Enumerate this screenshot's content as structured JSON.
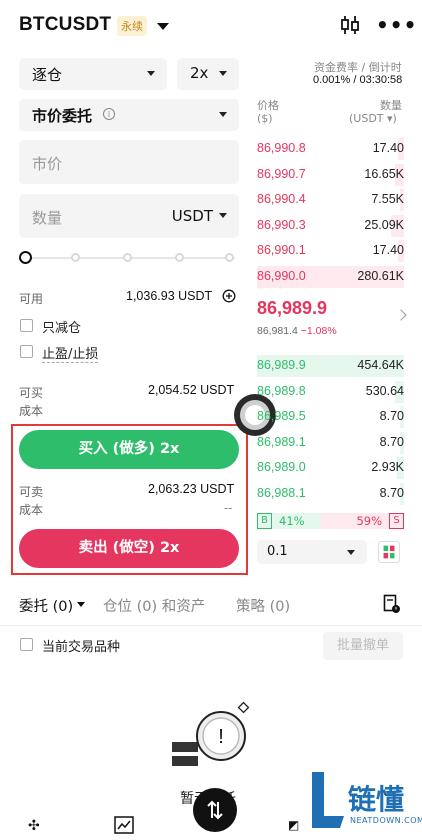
{
  "header": {
    "pair": "BTCUSDT",
    "badge": "永续"
  },
  "left": {
    "margin_mode": "逐仓",
    "leverage": "2x",
    "order_type": "市价委托",
    "price_placeholder": "市价",
    "qty_placeholder": "数量",
    "qty_unit": "USDT",
    "available_label": "可用",
    "available_value": "1,036.93 USDT",
    "reduce_only": "只减仓",
    "tpsl": "止盈/止损",
    "can_buy_label": "可买",
    "can_buy_value": "2,054.52 USDT",
    "cost_label": "成本",
    "buy_button": "买入 (做多) 2x",
    "can_sell_label": "可卖",
    "can_sell_value": "2,063.23 USDT",
    "cost_label2": "成本",
    "cost_value2": "--",
    "sell_button": "卖出 (做空) 2x"
  },
  "orderbook": {
    "funding_label": "资金费率 / 倒计时",
    "funding_value": "0.001% / 03:30:58",
    "price_header": "价格",
    "price_unit": "($)",
    "qty_header": "数量",
    "qty_unit": "(USDT ▾)",
    "asks": [
      {
        "price": "86,990.8",
        "qty": "17.40",
        "depth": 0.04
      },
      {
        "price": "86,990.7",
        "qty": "16.65K",
        "depth": 0.06
      },
      {
        "price": "86,990.4",
        "qty": "7.55K",
        "depth": 0.03
      },
      {
        "price": "86,990.3",
        "qty": "25.09K",
        "depth": 0.09
      },
      {
        "price": "86,990.1",
        "qty": "17.40",
        "depth": 0.04
      },
      {
        "price": "86,990.0",
        "qty": "280.61K",
        "depth": 1.0
      }
    ],
    "last_price": "86,989.9",
    "mark_price": "86,981.4",
    "change": "−1.08%",
    "bids": [
      {
        "price": "86,989.9",
        "qty": "454.64K",
        "depth": 1.0
      },
      {
        "price": "86,989.8",
        "qty": "530.64",
        "depth": 0.06
      },
      {
        "price": "86,989.5",
        "qty": "8.70",
        "depth": 0.03
      },
      {
        "price": "86,989.1",
        "qty": "8.70",
        "depth": 0.03
      },
      {
        "price": "86,989.0",
        "qty": "2.93K",
        "depth": 0.05
      },
      {
        "price": "86,988.1",
        "qty": "8.70",
        "depth": 0.03
      }
    ],
    "buy_tag": "B",
    "buy_pct": "41%",
    "sell_pct": "59%",
    "sell_tag": "S",
    "precision": "0.1"
  },
  "tabs": {
    "orders": "委托 (0)",
    "positions": "仓位 (0) 和资产",
    "strategies": "策略 (0)",
    "current_pair": "当前交易品种",
    "batch_cancel": "批量撤单",
    "empty": "暂无委托"
  },
  "watermark": {
    "brand": "链懂",
    "site": "NEATDOWN.COM"
  },
  "colors": {
    "buy": "#2ebd6b",
    "sell": "#e5365f",
    "highlight": "#e23a3a"
  }
}
